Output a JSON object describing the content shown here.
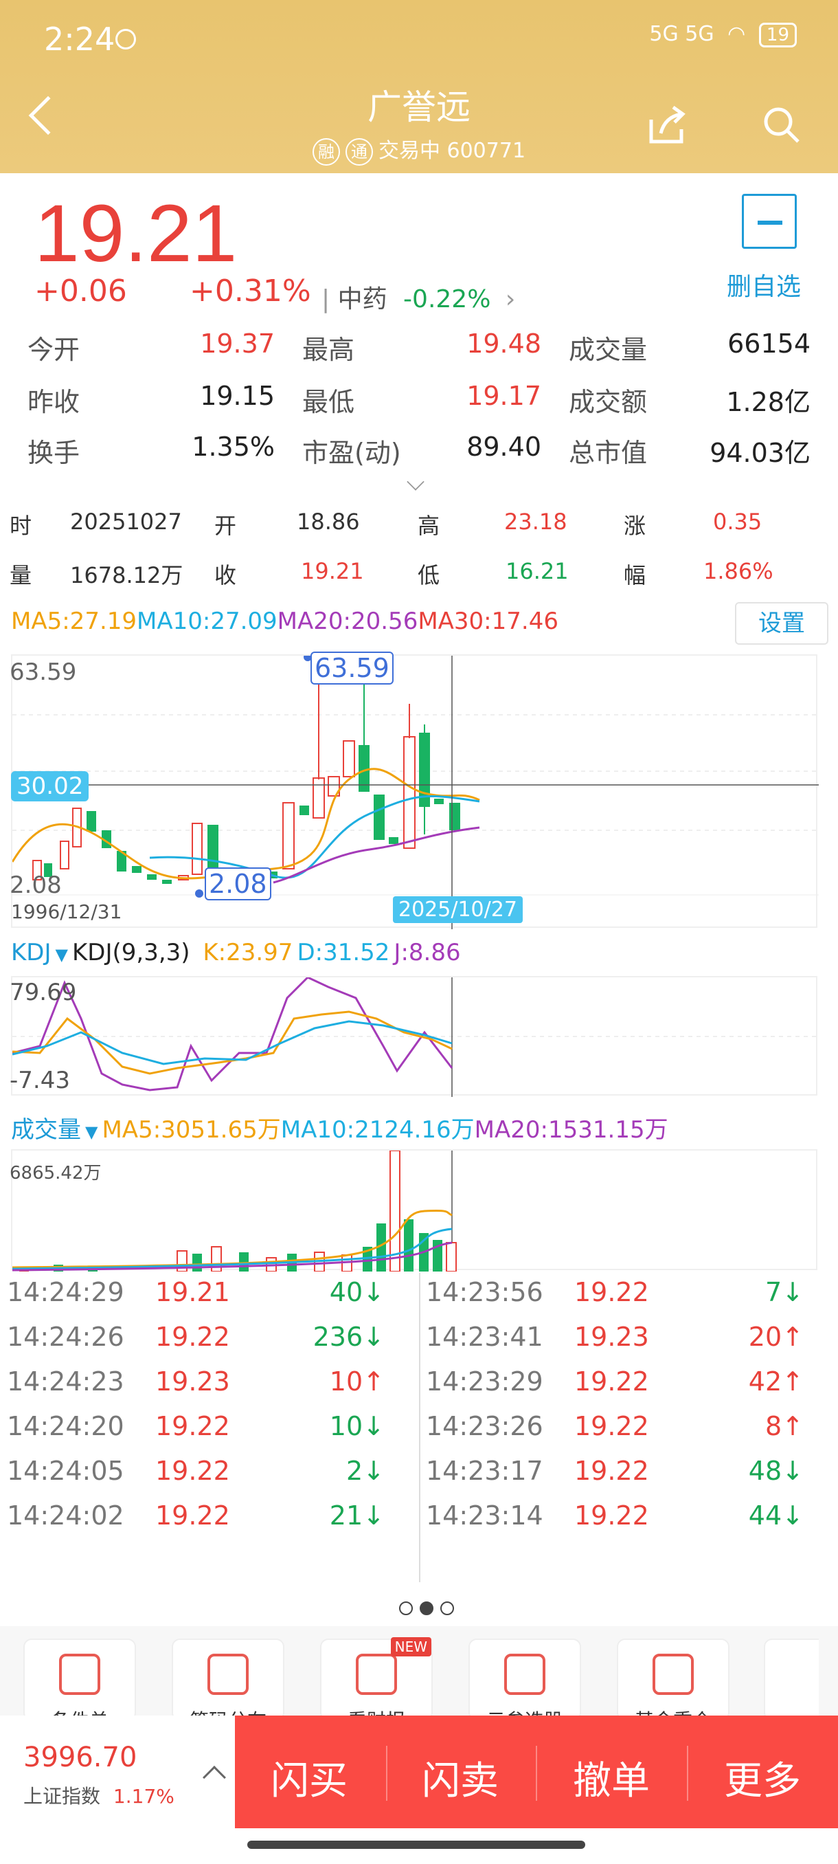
{
  "status": {
    "time": "2:24",
    "network": "5G 5G",
    "battery": "19"
  },
  "header": {
    "title": "广誉远",
    "badge1": "融",
    "badge2": "通",
    "status_text": "交易中 600771"
  },
  "quote": {
    "price": "19.21",
    "change": "+0.06",
    "change_pct": "+0.31%",
    "sector_name": "中药",
    "sector_change": "-0.22%",
    "watch_label": "删自选"
  },
  "stats": [
    {
      "label": "今开",
      "value": "19.37",
      "color": "red"
    },
    {
      "label": "最高",
      "value": "19.48",
      "color": "red"
    },
    {
      "label": "成交量",
      "value": "66154",
      "color": "dark"
    },
    {
      "label": "昨收",
      "value": "19.15",
      "color": "dark"
    },
    {
      "label": "最低",
      "value": "19.17",
      "color": "red"
    },
    {
      "label": "成交额",
      "value": "1.28亿",
      "color": "dark"
    },
    {
      "label": "换手",
      "value": "1.35%",
      "color": "dark"
    },
    {
      "label": "市盈(动)",
      "value": "89.40",
      "color": "dark"
    },
    {
      "label": "总市值",
      "value": "94.03亿",
      "color": "dark"
    }
  ],
  "bar_info": {
    "row1": {
      "l1": "时",
      "v1": "20251027",
      "l2": "开",
      "v2": "18.86",
      "l3": "高",
      "v3": "23.18",
      "l4": "涨",
      "v4": "0.35"
    },
    "row2": {
      "l1": "量",
      "v1": "1678.12万",
      "l2": "收",
      "v2": "19.21",
      "l3": "低",
      "v3": "16.21",
      "l4": "幅",
      "v4": "1.86%"
    }
  },
  "ma": {
    "ma5": "MA5:27.19",
    "ma10": "MA10:27.09",
    "ma20": "MA20:20.56",
    "ma30": "MA30:17.46",
    "setting": "设置"
  },
  "kline": {
    "max": "63.59",
    "max_tag": "63.59",
    "min": "2.08",
    "min_tag": "2.08",
    "cursor_price": "30.02",
    "start_date": "1996/12/31",
    "cursor_date": "2025/10/27"
  },
  "kdj": {
    "title": "KDJ",
    "params": "KDJ(9,3,3)",
    "k": "K:23.97",
    "d": "D:31.52",
    "j": "J:8.86",
    "max": "79.69",
    "min": "-7.43"
  },
  "volume": {
    "title": "成交量",
    "ma5": "MA5:3051.65万",
    "ma10": "MA10:2124.16万",
    "ma20": "MA20:1531.15万",
    "max": "6865.42万"
  },
  "trades_left": [
    {
      "time": "14:24:29",
      "price": "19.21",
      "vol": "40",
      "dir": "↓"
    },
    {
      "time": "14:24:26",
      "price": "19.22",
      "vol": "236",
      "dir": "↓"
    },
    {
      "time": "14:24:23",
      "price": "19.23",
      "vol": "10",
      "dir": "↑"
    },
    {
      "time": "14:24:20",
      "price": "19.22",
      "vol": "10",
      "dir": "↓"
    },
    {
      "time": "14:24:05",
      "price": "19.22",
      "vol": "2",
      "dir": "↓"
    },
    {
      "time": "14:24:02",
      "price": "19.22",
      "vol": "21",
      "dir": "↓"
    }
  ],
  "trades_right": [
    {
      "time": "14:23:56",
      "price": "19.22",
      "vol": "7",
      "dir": "↓"
    },
    {
      "time": "14:23:41",
      "price": "19.23",
      "vol": "20",
      "dir": "↑"
    },
    {
      "time": "14:23:29",
      "price": "19.22",
      "vol": "42",
      "dir": "↑"
    },
    {
      "time": "14:23:26",
      "price": "19.22",
      "vol": "8",
      "dir": "↑"
    },
    {
      "time": "14:23:17",
      "price": "19.22",
      "vol": "48",
      "dir": "↓"
    },
    {
      "time": "14:23:14",
      "price": "19.22",
      "vol": "44",
      "dir": "↓"
    }
  ],
  "tools": [
    {
      "label": "条件单",
      "icon": "conditional-order-icon"
    },
    {
      "label": "筹码分布",
      "icon": "chip-distribution-icon"
    },
    {
      "label": "看财报",
      "icon": "video-report-icon",
      "badge": "NEW"
    },
    {
      "label": "云参选股",
      "icon": "cloud-stock-icon"
    },
    {
      "label": "基金重仓",
      "icon": "fund-holding-icon"
    }
  ],
  "index": {
    "value": "3996.70",
    "name": "上证指数",
    "pct": "1.17%"
  },
  "actions": {
    "buy": "闪买",
    "sell": "闪卖",
    "cancel": "撤单",
    "more": "更多"
  }
}
